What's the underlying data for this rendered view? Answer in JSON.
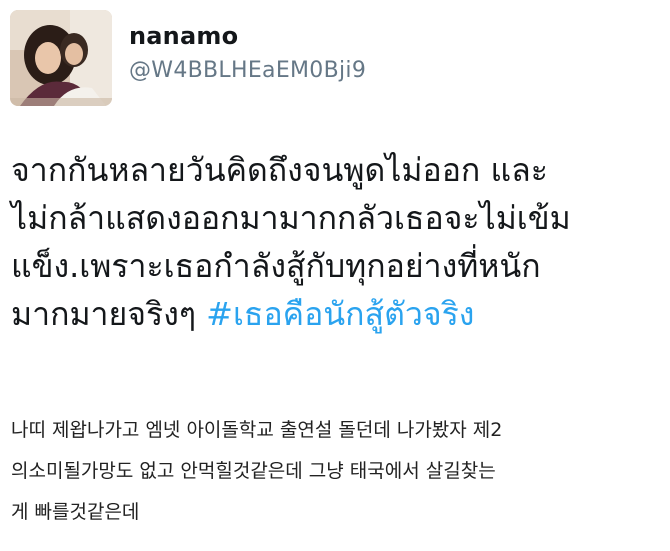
{
  "tweet": {
    "author": {
      "name": "nanamo",
      "handle": "@W4BBLHEaEM0Bji9"
    },
    "text_lines": [
      "จากกันหลายวันคิดถึงจนพูดไม่ออก และ",
      "ไม่กล้าแสดงออกมามากกลัวเธอจะไม่เข้ม",
      "แข็ง.เพราะเธอกำลังสู้กับทุกอย่างที่หนัก"
    ],
    "text_last_line_prefix": "มากมายจริงๆ ",
    "hashtag": "#เธอคือนักสู้ตัวจริง"
  },
  "comment": {
    "lines": [
      "나띠 제왑나가고 엠넷 아이돌학교 출연설 돌던데 나가봤자 제2",
      "의소미될가망도 없고 안먹힐것같은데 그냥 태국에서 살길찾는",
      "게 빠를것같은데"
    ]
  },
  "colors": {
    "hashtag": "#2aa3ef",
    "handle": "#657786",
    "text": "#14171a"
  }
}
